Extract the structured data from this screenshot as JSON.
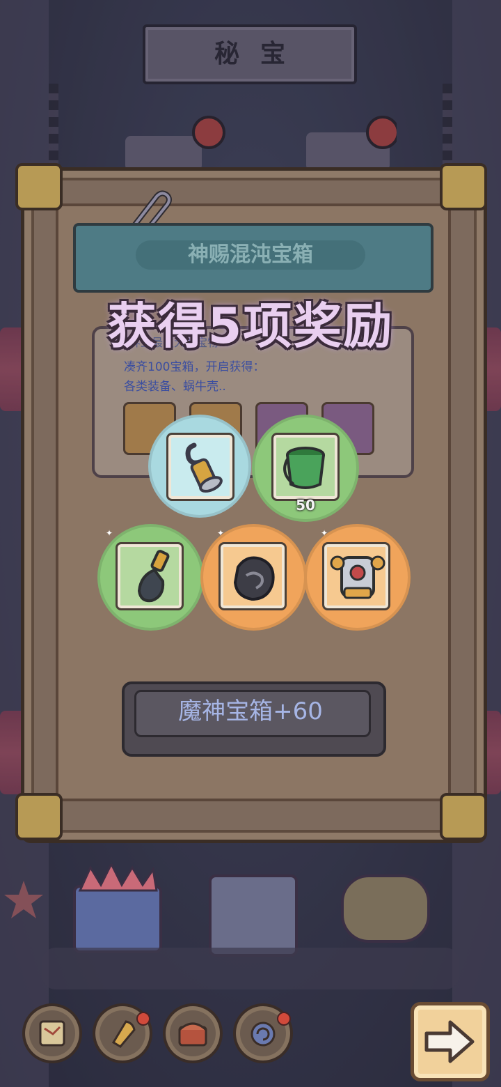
{
  "header": {
    "title": "秘宝"
  },
  "panel": {
    "chest_name": "神赐混沌宝箱",
    "info": {
      "partial_line": "世界上最强大的宝物...",
      "line1": "凑齐100宝箱，开启获得：",
      "line2": "各类装备、蜗牛壳.."
    }
  },
  "reward_popup": {
    "heading": "获得5项奖励",
    "rewards": [
      {
        "icon": "hook-icon",
        "rarity_color": "#a9d9e0",
        "quantity": ""
      },
      {
        "icon": "paint-bucket-icon",
        "rarity_color": "#8dc87a",
        "quantity": "50"
      },
      {
        "icon": "pendant-icon",
        "rarity_color": "#8dc87a",
        "quantity": ""
      },
      {
        "icon": "shell-icon",
        "rarity_color": "#f0a45b",
        "quantity": ""
      },
      {
        "icon": "armor-icon",
        "rarity_color": "#f0a45b",
        "quantity": ""
      }
    ],
    "bonus_label": "魔神宝箱+60"
  },
  "bottom_nav": {
    "items": [
      {
        "icon": "map-icon"
      },
      {
        "icon": "rocket-icon"
      },
      {
        "icon": "chest-icon"
      },
      {
        "icon": "snail-shell-icon"
      }
    ],
    "next_icon": "arrow-right-icon"
  }
}
